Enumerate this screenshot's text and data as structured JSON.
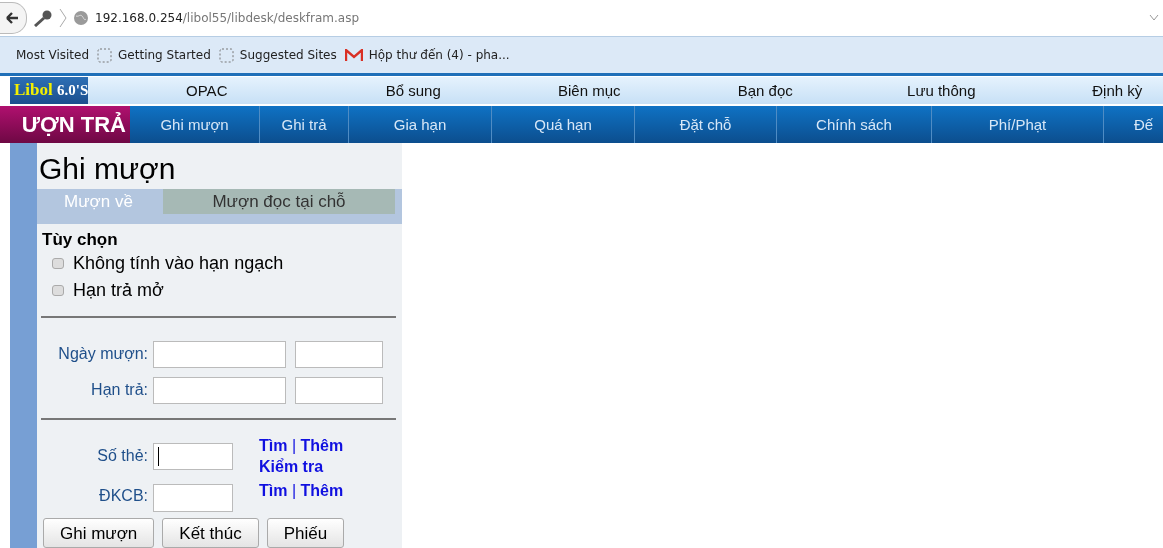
{
  "address_bar": {
    "host": "192.168.0.254",
    "path": "/libol55/libdesk/deskfram.asp"
  },
  "bookmarks": [
    {
      "label": "Most Visited",
      "kind": "plain"
    },
    {
      "label": "Getting Started",
      "kind": "page"
    },
    {
      "label": "Suggested Sites",
      "kind": "page"
    },
    {
      "label": "Hộp thư đến (4) - pha...",
      "kind": "mail"
    }
  ],
  "logo": {
    "name": "Libol",
    "version": "6.0'S"
  },
  "main_menu": [
    "OPAC",
    "Bổ sung",
    "Biên mục",
    "Bạn đọc",
    "Lưu thông",
    "Định kỳ"
  ],
  "section_title": "ƯỢN TRẢ",
  "sub_menu": [
    "Ghi mượn",
    "Ghi trả",
    "Gia hạn",
    "Quá hạn",
    "Đặt chỗ",
    "Chính sách",
    "Phí/Phạt",
    "Đế"
  ],
  "panel": {
    "title": "Ghi mượn",
    "tabs": [
      {
        "label": "Mượn về",
        "selected": true
      },
      {
        "label": "Mượn đọc tại chỗ",
        "selected": false
      }
    ],
    "options_heading": "Tùy chọn",
    "options": [
      {
        "label": "Không tính vào hạn ngạch",
        "checked": false
      },
      {
        "label": "Hạn trả mở",
        "checked": false
      }
    ],
    "date_fields": [
      {
        "label": "Ngày mượn:"
      },
      {
        "label": "Hạn trả:"
      }
    ],
    "card_field": {
      "label": "Số thẻ:",
      "links": [
        "Tìm",
        "Thêm",
        "Kiểm tra"
      ],
      "separator": "|"
    },
    "copy_field": {
      "label": "ĐKCB:",
      "links": [
        "Tìm",
        "Thêm"
      ],
      "separator": "|"
    },
    "buttons": [
      "Ghi mượn",
      "Kết thúc",
      "Phiếu"
    ]
  }
}
